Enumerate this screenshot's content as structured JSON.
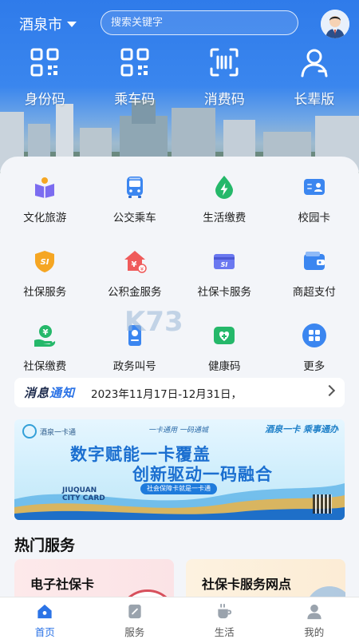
{
  "header": {
    "city": "酒泉市",
    "search_placeholder": "搜索关键字",
    "codes": [
      {
        "label": "身份码",
        "icon": "qr-code-icon"
      },
      {
        "label": "乘车码",
        "icon": "qr-code-icon"
      },
      {
        "label": "消费码",
        "icon": "scan-code-icon"
      },
      {
        "label": "长辈版",
        "icon": "elder-user-icon"
      }
    ]
  },
  "services": [
    {
      "label": "文化旅游",
      "icon": "book-icon"
    },
    {
      "label": "公交乘车",
      "icon": "bus-icon"
    },
    {
      "label": "生活缴费",
      "icon": "lightning-drop-icon"
    },
    {
      "label": "校园卡",
      "icon": "id-card-icon"
    },
    {
      "label": "社保服务",
      "icon": "social-security-shield-icon"
    },
    {
      "label": "公积金服务",
      "icon": "house-fund-icon"
    },
    {
      "label": "社保卡服务",
      "icon": "social-security-card-icon"
    },
    {
      "label": "商超支付",
      "icon": "wallet-icon"
    },
    {
      "label": "社保缴费",
      "icon": "payment-hand-icon"
    },
    {
      "label": "政务叫号",
      "icon": "queue-ticket-icon"
    },
    {
      "label": "健康码",
      "icon": "health-code-icon"
    },
    {
      "label": "更多",
      "icon": "more-grid-icon"
    }
  ],
  "notice": {
    "tag_part1": "消息",
    "tag_part2": "通知",
    "text": "2023年11月17日-12月31日，"
  },
  "banner": {
    "brand": "酒泉一卡通",
    "tagline": "一卡通用 一码通城",
    "slogan": "酒泉一卡 乘事通办",
    "headline1": "数字赋能一卡覆盖",
    "headline2": "创新驱动一码融合",
    "pill": "社会保障卡就是一卡通",
    "city_en": "JIUQUAN",
    "card_en": "CITY CARD"
  },
  "hot": {
    "title": "热门服务",
    "cards": [
      "电子社保卡",
      "社保卡服务网点"
    ]
  },
  "tabbar": [
    {
      "label": "首页",
      "icon": "home-icon",
      "active": true
    },
    {
      "label": "服务",
      "icon": "service-icon",
      "active": false
    },
    {
      "label": "生活",
      "icon": "life-cup-icon",
      "active": false
    },
    {
      "label": "我的",
      "icon": "profile-icon",
      "active": false
    }
  ],
  "colors": {
    "primary": "#2b73e6",
    "header_blue": "#2f7bea",
    "background": "#f3f5f9"
  }
}
